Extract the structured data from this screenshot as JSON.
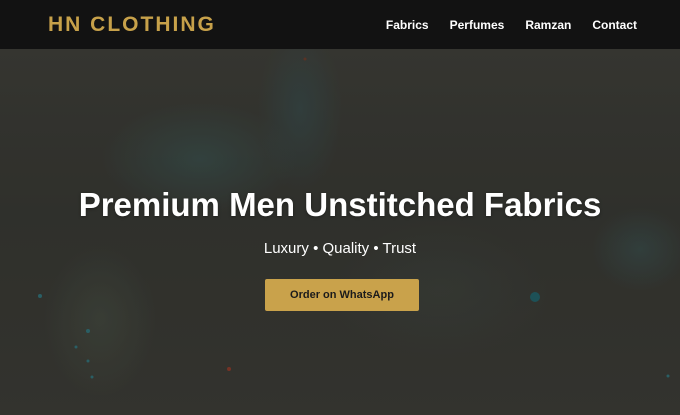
{
  "navbar": {
    "brand": "HN CLOTHING",
    "links": [
      {
        "label": "Fabrics"
      },
      {
        "label": "Perfumes"
      },
      {
        "label": "Ramzan"
      },
      {
        "label": "Contact"
      }
    ]
  },
  "hero": {
    "title": "Premium Men Unstitched Fabrics",
    "subtitle": "Luxury • Quality • Trust",
    "cta_label": "Order on WhatsApp"
  },
  "colors": {
    "navbar_bg": "#121212",
    "brand": "#c7a14a",
    "cta_bg": "#c9a24b",
    "text": "#ffffff"
  }
}
